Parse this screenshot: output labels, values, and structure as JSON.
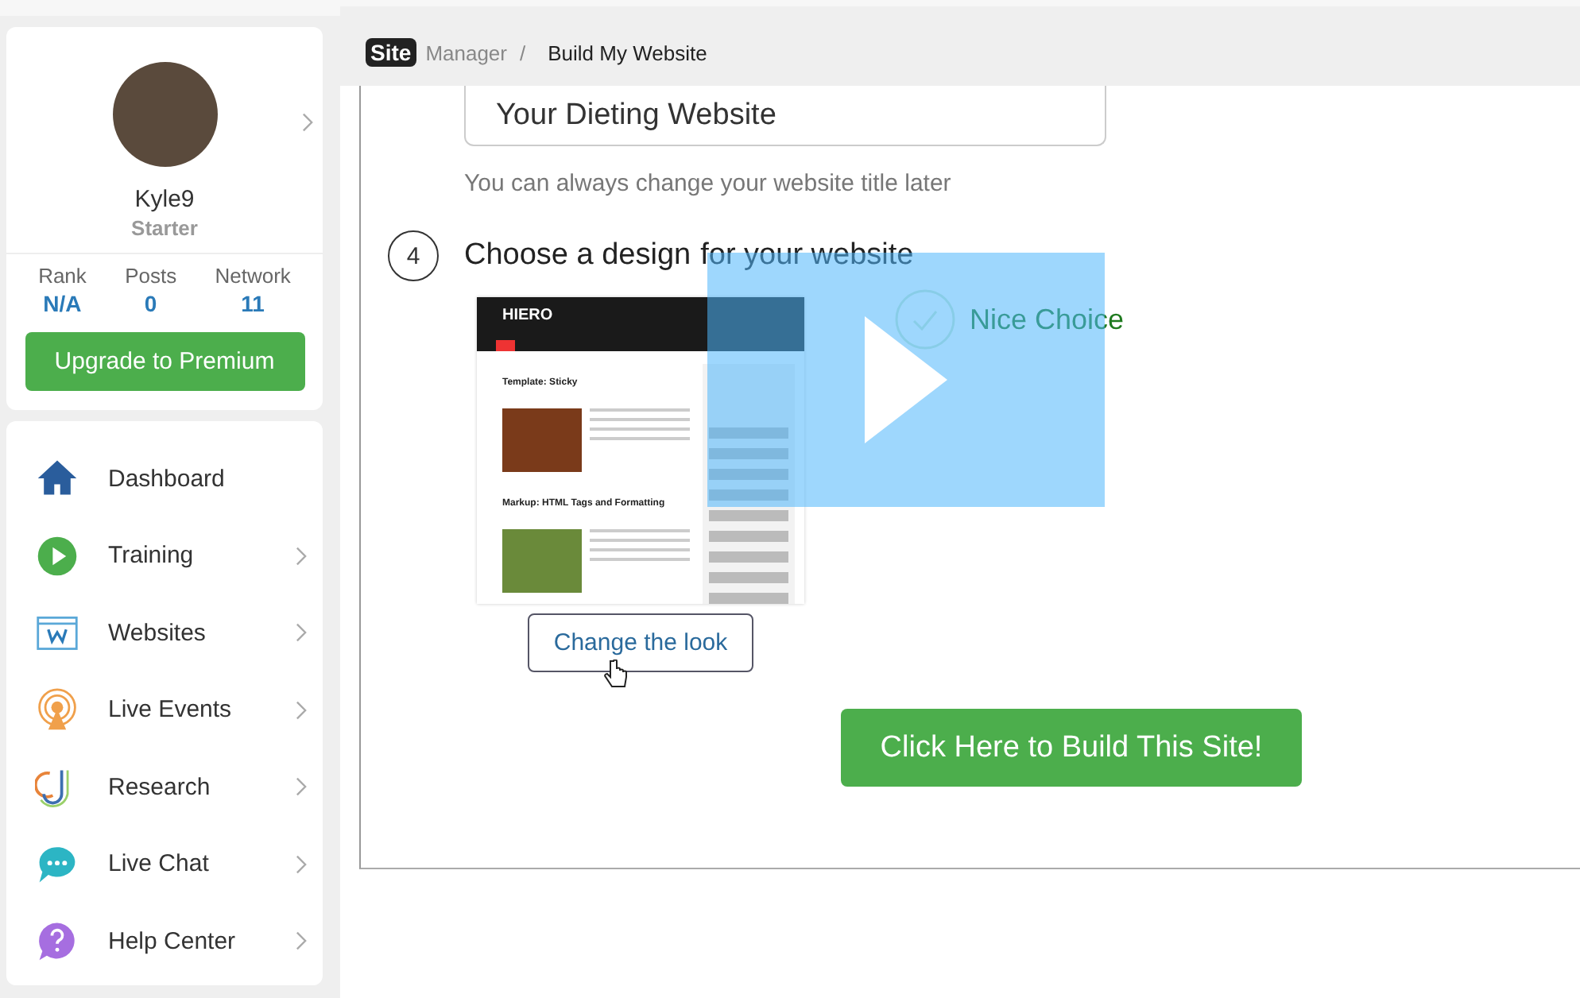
{
  "profile": {
    "name": "Kyle9",
    "level": "Starter",
    "stats": [
      {
        "label": "Rank",
        "value": "N/A"
      },
      {
        "label": "Posts",
        "value": "0"
      },
      {
        "label": "Network",
        "value": "11"
      }
    ],
    "upgrade_button": "Upgrade to Premium"
  },
  "nav": [
    {
      "kind": "home",
      "label": "Dashboard",
      "has_arrow": false
    },
    {
      "kind": "play",
      "label": "Training",
      "has_arrow": true
    },
    {
      "kind": "web",
      "label": "Websites",
      "has_arrow": true
    },
    {
      "kind": "live",
      "label": "Live Events",
      "has_arrow": true
    },
    {
      "kind": "research",
      "label": "Research",
      "has_arrow": true
    },
    {
      "kind": "chat",
      "label": "Live Chat",
      "has_arrow": true
    },
    {
      "kind": "help",
      "label": "Help Center",
      "has_arrow": true
    }
  ],
  "breadcrumb": {
    "logo_badge": "Site",
    "logo_text": "Manager",
    "separator": "/",
    "current": "Build My Website"
  },
  "step3": {
    "value": "Your Dieting Website",
    "hint": "You can always change your website title later"
  },
  "step4": {
    "number": "4",
    "title_main": "Choose a design",
    "title_rest": "for your website",
    "preview": {
      "brand": "HIERO",
      "posts": [
        "Template: Sticky",
        "Markup: HTML Tags and Formatting"
      ]
    },
    "confirmation": "Nice Choice",
    "change_button": "Change the look"
  },
  "build_button": "Click Here to Build This Site!"
}
